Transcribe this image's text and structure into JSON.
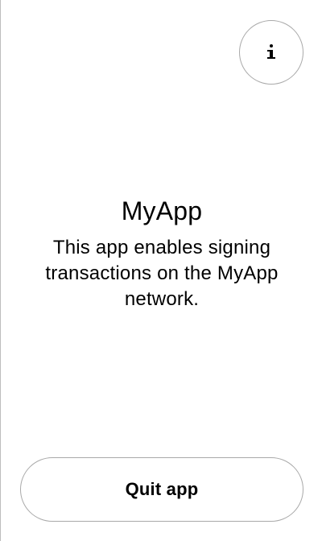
{
  "app": {
    "name": "MyApp",
    "description": "This app enables signing transactions on the MyApp network."
  },
  "header": {
    "info_icon": "info-icon"
  },
  "actions": {
    "quit_label": "Quit app"
  },
  "colors": {
    "border": "#a9a9a9",
    "text": "#000000",
    "background": "#ffffff"
  }
}
